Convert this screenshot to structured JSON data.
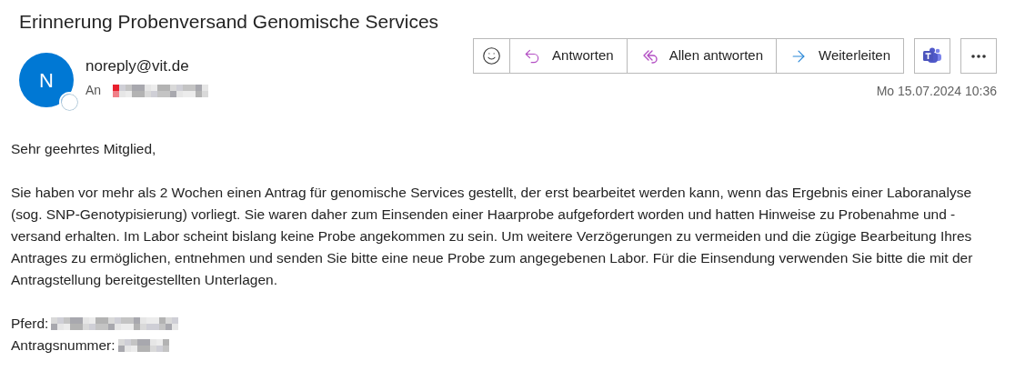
{
  "title": "Erinnerung Probenversand Genomische Services",
  "sender": {
    "initial": "N",
    "address": "noreply@vit.de"
  },
  "recipient_label": "An",
  "actions": [
    {
      "kind": "react"
    },
    {
      "kind": "reply",
      "label": "Antworten"
    },
    {
      "kind": "reply_all",
      "label": "Allen antworten"
    },
    {
      "kind": "forward",
      "label": "Weiterleiten"
    }
  ],
  "extra_buttons": [
    {
      "kind": "teams"
    },
    {
      "kind": "more"
    }
  ],
  "timestamp": "Mo 15.07.2024 10:36",
  "body": {
    "greeting": "Sehr geehrtes Mitglied,",
    "paragraph": "Sie haben vor mehr als 2 Wochen einen Antrag für genomische Services gestellt, der erst bearbeitet werden kann, wenn das Ergebnis einer Laboranalyse (sog. SNP-Genotypisierung) vorliegt. Sie waren daher zum Einsenden einer Haarprobe aufgefordert worden und hatten Hinweise zu Probenahme und -versand erhalten. Im Labor scheint bislang keine Probe angekommen zu sein. Um weitere Verzögerungen zu vermeiden und die zügige Bearbeitung Ihres Antrages zu ermöglichen, entnehmen und senden Sie bitte eine neue Probe zum angegebenen Labor. Für die Einsendung verwenden Sie bitte die mit der Antragstellung bereitgestellten Unterlagen.",
    "fields": [
      {
        "label": "Pferd:"
      },
      {
        "label": "Antragsnummer:"
      }
    ]
  }
}
